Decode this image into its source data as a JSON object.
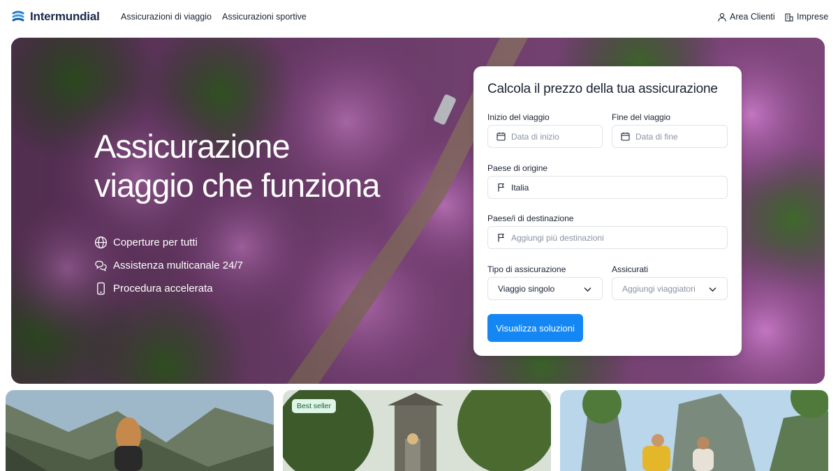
{
  "brand": {
    "name": "Intermundial"
  },
  "nav": {
    "links": [
      "Assicurazioni di viaggio",
      "Assicurazioni sportive"
    ],
    "area_clienti": "Area Clienti",
    "imprese": "Imprese"
  },
  "hero": {
    "title_line1": "Assicurazione",
    "title_line2": "viaggio che funziona",
    "features": [
      {
        "icon": "globe-icon",
        "label": "Coperture per tutti"
      },
      {
        "icon": "chat-bubbles-icon",
        "label": "Assistenza multicanale 24/7"
      },
      {
        "icon": "smartphone-icon",
        "label": "Procedura accelerata"
      }
    ]
  },
  "form": {
    "title": "Calcola il prezzo della tua assicurazione",
    "start_label": "Inizio del viaggio",
    "start_placeholder": "Data di inizio",
    "end_label": "Fine del viaggio",
    "end_placeholder": "Data di fine",
    "origin_label": "Paese di origine",
    "origin_value": "Italia",
    "destination_label": "Paese/i di destinazione",
    "destination_placeholder": "Aggiungi più destinazioni",
    "type_label": "Tipo di assicurazione",
    "type_value": "Viaggio singolo",
    "insured_label": "Assicurati",
    "insured_placeholder": "Aggiungi viaggiatori",
    "submit": "Visualizza soluzioni"
  },
  "product_cards": [
    {
      "badge": ""
    },
    {
      "badge": "Best seller"
    },
    {
      "badge": ""
    }
  ],
  "colors": {
    "accent": "#1487f5",
    "brand_dark": "#1b2a4a",
    "badge_bg": "#dff5e6"
  }
}
